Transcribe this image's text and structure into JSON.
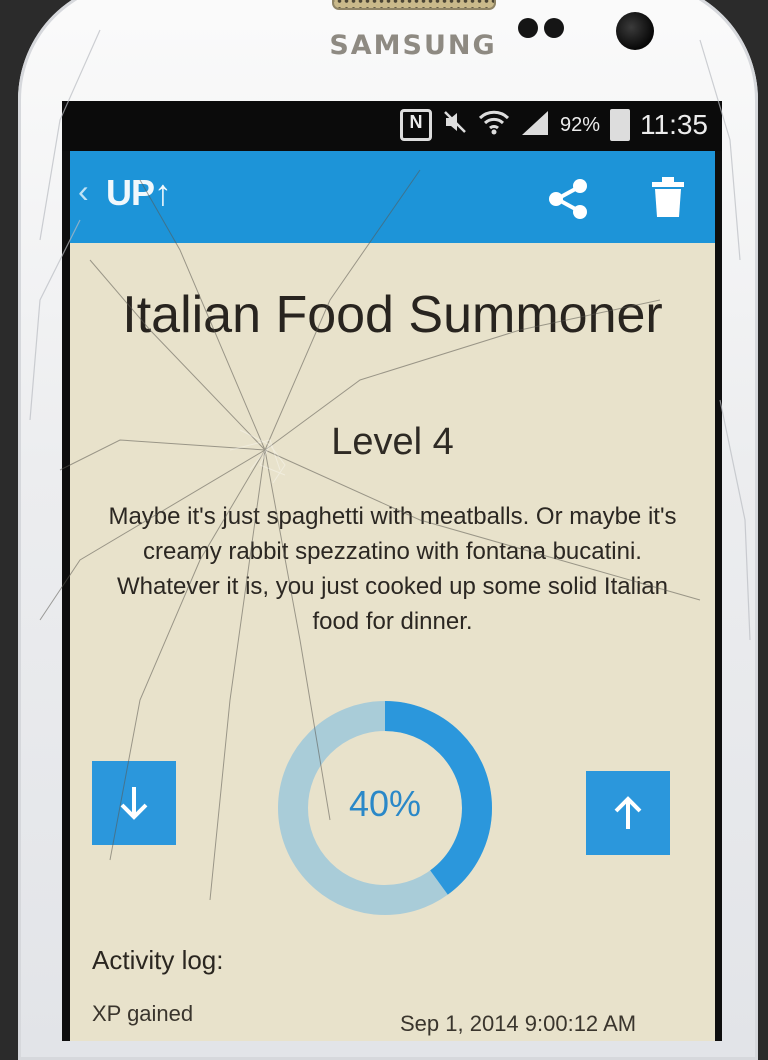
{
  "device": {
    "brand": "SAMSUNG"
  },
  "status_bar": {
    "battery": "92%",
    "time": "11:35",
    "icons": [
      "nfc-icon",
      "mute-icon",
      "wifi-icon",
      "signal-icon",
      "battery-icon"
    ]
  },
  "app_bar": {
    "logo": "UP↑",
    "icons": [
      "back-icon",
      "share-icon",
      "trash-icon"
    ],
    "color": "#1d94d8"
  },
  "skill": {
    "title": "Italian Food Summoner",
    "level": "Level 4",
    "description": "Maybe it's just spaghetti with meatballs. Or maybe it's creamy rabbit spezzatino with fontana bucatini. Whatever it is, you just cooked up some solid Italian food for dinner.",
    "progress_label": "40%",
    "progress": 0.4,
    "progress_color": "#2b97dc",
    "track_color": "#a9ccd8"
  },
  "buttons": {
    "down_icon": "arrow-down-icon",
    "up_icon": "arrow-up-icon"
  },
  "activity": {
    "heading": "Activity log:",
    "entries": [
      {
        "label": "XP gained",
        "date": "Sep 1, 2014 9:00:12 AM"
      }
    ]
  }
}
